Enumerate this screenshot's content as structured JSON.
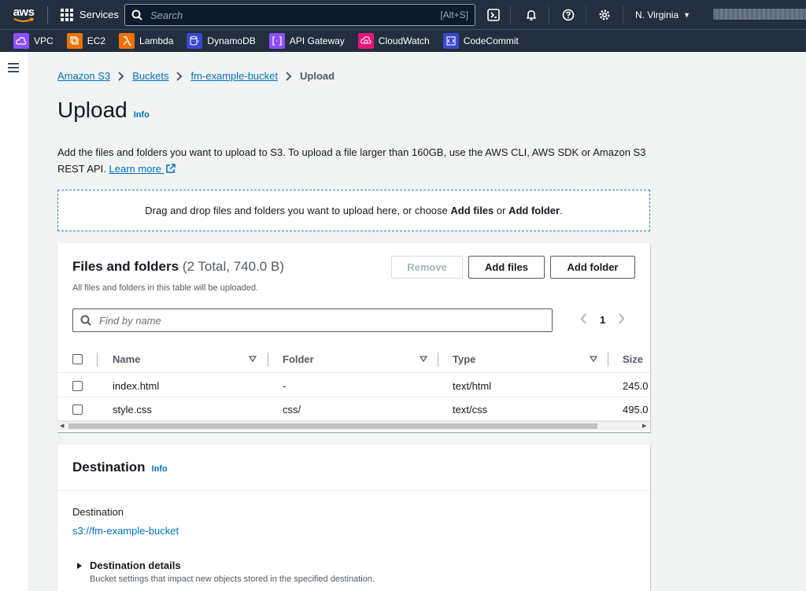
{
  "topbar": {
    "logo": "aws",
    "services_label": "Services",
    "search_placeholder": "Search",
    "search_shortcut": "[Alt+S]",
    "region": "N. Virginia"
  },
  "favorites": [
    {
      "label": "VPC",
      "color": "#8c4fff",
      "icon": "vpc-icon"
    },
    {
      "label": "EC2",
      "color": "#ed7100",
      "icon": "ec2-icon"
    },
    {
      "label": "Lambda",
      "color": "#ed7100",
      "icon": "lambda-icon"
    },
    {
      "label": "DynamoDB",
      "color": "#3b48cc",
      "icon": "dynamodb-icon"
    },
    {
      "label": "API Gateway",
      "color": "#8c4fff",
      "icon": "api-gateway-icon"
    },
    {
      "label": "CloudWatch",
      "color": "#e7157b",
      "icon": "cloudwatch-icon"
    },
    {
      "label": "CodeCommit",
      "color": "#3b48cc",
      "icon": "codecommit-icon"
    }
  ],
  "breadcrumb": {
    "items": [
      "Amazon S3",
      "Buckets",
      "fm-example-bucket"
    ],
    "current": "Upload"
  },
  "page": {
    "title": "Upload",
    "info": "Info",
    "description": "Add the files and folders you want to upload to S3. To upload a file larger than 160GB, use the AWS CLI, AWS SDK or Amazon S3 REST API.",
    "learn_more": "Learn more",
    "dropzone_prefix": "Drag and drop files and folders you want to upload here, or choose ",
    "dropzone_add_files": "Add files",
    "dropzone_or": " or ",
    "dropzone_add_folder": "Add folder",
    "dropzone_suffix": "."
  },
  "files_panel": {
    "title": "Files and folders",
    "count": "(2 Total, 740.0 B)",
    "subtitle": "All files and folders in this table will be uploaded.",
    "remove_label": "Remove",
    "add_files_label": "Add files",
    "add_folder_label": "Add folder",
    "find_placeholder": "Find by name",
    "page_number": "1",
    "columns": [
      "Name",
      "Folder",
      "Type",
      "Size"
    ],
    "rows": [
      {
        "name": "index.html",
        "folder": "-",
        "type": "text/html",
        "size": "245.0"
      },
      {
        "name": "style.css",
        "folder": "css/",
        "type": "text/css",
        "size": "495.0"
      }
    ]
  },
  "destination_panel": {
    "title": "Destination",
    "info": "Info",
    "label": "Destination",
    "value": "s3://fm-example-bucket",
    "details_title": "Destination details",
    "details_sub": "Bucket settings that impact new objects stored in the specified destination."
  }
}
